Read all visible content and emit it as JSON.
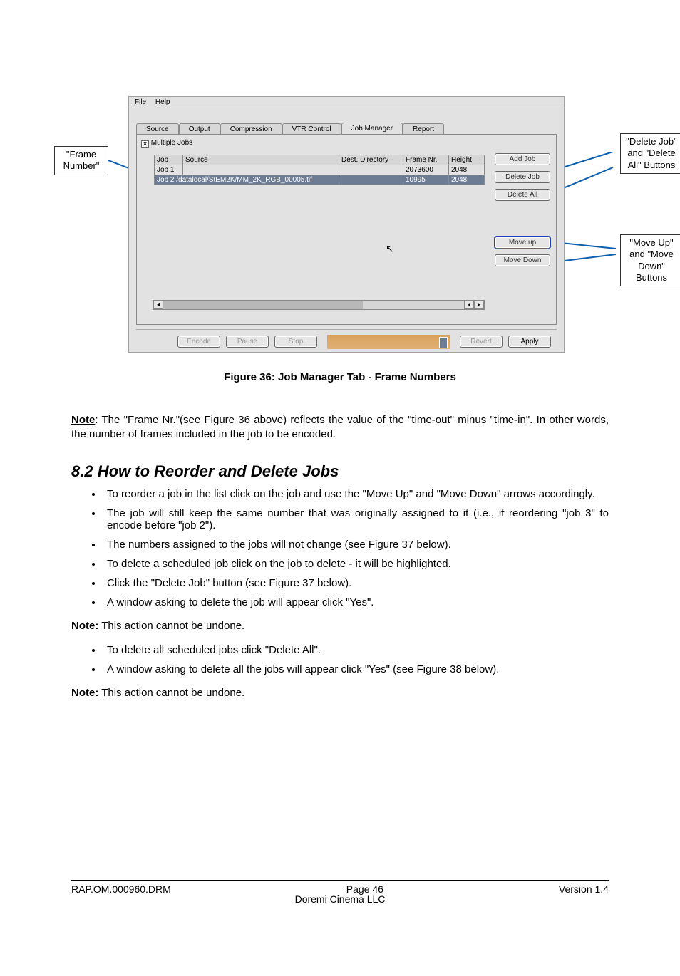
{
  "callouts": {
    "frame_number": "\"Frame Number\"",
    "delete_buttons": "\"Delete Job\" and \"Delete All\" Buttons",
    "move_buttons": "\"Move Up\" and \"Move Down\" Buttons"
  },
  "app": {
    "menu": {
      "file": "File",
      "help": "Help"
    },
    "tabs": {
      "source": "Source",
      "output": "Output",
      "compression": "Compression",
      "vtr": "VTR Control",
      "job_manager": "Job Manager",
      "report": "Report"
    },
    "multiple_jobs_label": "Multiple Jobs",
    "multiple_jobs_check": "✕",
    "table": {
      "headers": {
        "job": "Job",
        "source": "Source",
        "dest": "Dest. Directory",
        "frame": "Frame Nr.",
        "height": "Height"
      },
      "rows": [
        {
          "job": "Job 1",
          "source": "",
          "dest": "",
          "frame": "2073600",
          "height": "2048"
        },
        {
          "job": "Job 2",
          "source": "/datalocal/StEM2K/MM_2K_RGB_00005.tif",
          "dest": "",
          "frame": "10995",
          "height": "2048"
        }
      ]
    },
    "side_buttons": {
      "add_job": "Add Job",
      "delete_job": "Delete Job",
      "delete_all": "Delete All",
      "move_up": "Move up",
      "move_down": "Move Down"
    },
    "bottom": {
      "encode": "Encode",
      "pause": "Pause",
      "stop": "Stop",
      "revert": "Revert",
      "apply": "Apply"
    }
  },
  "figure_caption": "Figure 36: Job Manager Tab - Frame Numbers",
  "note_label": "Note",
  "note1_text": ": The \"Frame Nr.\"(see Figure 36 above) reflects the value of the \"time-out\" minus \"time-in\". In other words, the number of frames included in the job to be encoded.",
  "section_heading": "8.2  How to Reorder and Delete Jobs",
  "bullets": [
    "To reorder a job in the list click on the job and use the \"Move Up\" and \"Move Down\" arrows accordingly.",
    "The job will still keep the same number that was originally assigned to it (i.e., if reordering \"job 3\" to encode before \"job 2\").",
    "The numbers assigned to the jobs will not change (see Figure 37 below).",
    "To delete a scheduled job click on the job to delete - it will be highlighted.",
    "Click the \"Delete Job\" button (see Figure 37 below).",
    "A window asking to delete the job will appear click \"Yes\"."
  ],
  "note2_label": "Note:",
  "note2_text": " This action cannot be undone.",
  "bullets2": [
    "To delete all scheduled jobs click \"Delete All\".",
    "A window asking to delete all the jobs will appear click \"Yes\" (see Figure 38 below)."
  ],
  "note3_label": "Note:",
  "note3_text": " This action cannot be undone.",
  "footer": {
    "doc_id": "RAP.OM.000960.DRM",
    "page_label": "Page ",
    "page_num": "46",
    "version": "Version 1.4",
    "company": "Doremi Cinema LLC"
  }
}
